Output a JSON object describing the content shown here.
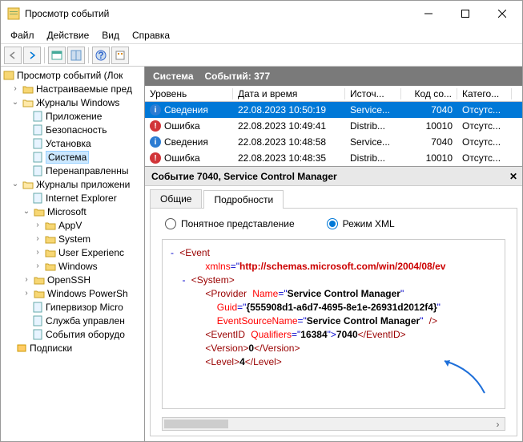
{
  "window": {
    "title": "Просмотр событий"
  },
  "menu": {
    "file": "Файл",
    "action": "Действие",
    "view": "Вид",
    "help": "Справка"
  },
  "tree": {
    "root": "Просмотр событий (Лок",
    "custom": "Настраиваемые пред",
    "winlogs": "Журналы Windows",
    "app": "Приложение",
    "security": "Безопасность",
    "setup": "Установка",
    "system": "Система",
    "forwarded": "Перенаправленны",
    "applogs": "Журналы приложени",
    "ie": "Internet Explorer",
    "ms": "Microsoft",
    "appv": "AppV",
    "sysnode": "System",
    "ux": "User Experienc",
    "windows": "Windows",
    "openssh": "OpenSSH",
    "powershell": "Windows PowerSh",
    "hyperv": "Гипервизор Micro",
    "svcmgr": "Служба управлен",
    "hwevents": "События оборудо",
    "subs": "Подписки"
  },
  "header": {
    "title": "Система",
    "count_label": "Событий: 377"
  },
  "cols": {
    "level": "Уровень",
    "datetime": "Дата и время",
    "source": "Источ...",
    "code": "Код со...",
    "cat": "Катего..."
  },
  "rows": [
    {
      "icon": "info",
      "level": "Сведения",
      "dt": "22.08.2023 10:50:19",
      "src": "Service...",
      "code": "7040",
      "cat": "Отсутс..."
    },
    {
      "icon": "error",
      "level": "Ошибка",
      "dt": "22.08.2023 10:49:41",
      "src": "Distrib...",
      "code": "10010",
      "cat": "Отсутс..."
    },
    {
      "icon": "info",
      "level": "Сведения",
      "dt": "22.08.2023 10:48:58",
      "src": "Service...",
      "code": "7040",
      "cat": "Отсутс..."
    },
    {
      "icon": "error",
      "level": "Ошибка",
      "dt": "22.08.2023 10:48:35",
      "src": "Distrib...",
      "code": "10010",
      "cat": "Отсутс..."
    }
  ],
  "event": {
    "title": "Событие 7040, Service Control Manager",
    "tab_general": "Общие",
    "tab_details": "Подробности",
    "radio_friendly": "Понятное представление",
    "radio_xml": "Режим XML",
    "xml": {
      "ns": "http://schemas.microsoft.com/win/2004/08/ev",
      "provider": "Service Control Manager",
      "guid": "{555908d1-a6d7-4695-8e1e-26931d2012f4}",
      "esname": "Service Control Manager",
      "qualifiers": "16384",
      "eventid": "7040",
      "version": "0",
      "level": "4"
    }
  }
}
